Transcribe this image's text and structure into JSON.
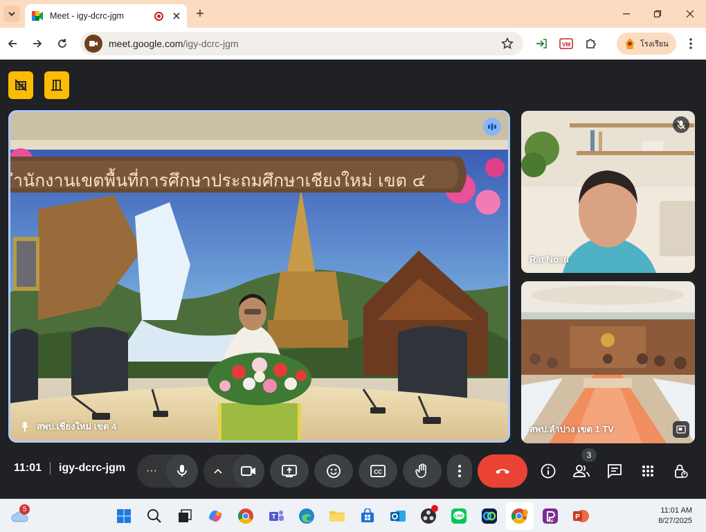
{
  "browser": {
    "tab_title": "Meet - igy-dcrc-jgm",
    "url_host": "meet.google.com",
    "url_path": "/igy-dcrc-jgm",
    "profile_name": "โรงเรียน",
    "new_tab_symbol": "+",
    "window_controls": [
      "minimize-icon",
      "maximize-icon",
      "close-icon"
    ]
  },
  "meet": {
    "main_tile": {
      "banner_text": "ำนักงานเขตพื้นที่การศึกษาประถมศึกษาเชียงใหม่ เขต ๔",
      "label": "สพป.เชียงใหม่ เขต 4"
    },
    "side_tiles": [
      {
        "label": "Rat Nosu",
        "muted": true
      },
      {
        "label": "สพป.ลำปาง เขต 1 TV",
        "muted": false
      }
    ],
    "time": "11:01",
    "meeting_code": "igy-dcrc-jgm",
    "participants_count": "3",
    "more_dots": "···"
  },
  "taskbar": {
    "weather_badge": "5",
    "clock_time": "11:01 AM",
    "clock_date": "8/27/2025"
  },
  "colors": {
    "accent_yellow": "#fbbc04",
    "end_call_red": "#ea4335",
    "tile_highlight": "#aecbfa",
    "tab_strip": "#fbdcc0"
  }
}
